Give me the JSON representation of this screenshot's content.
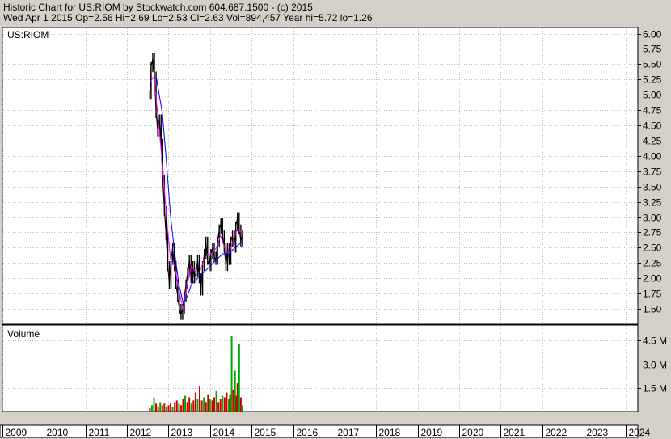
{
  "header": {
    "line1": "Historic Chart for US:RIOM by Stockwatch.com 604.687.1500 - (c) 2015",
    "line2": "Wed Apr  1 2015  Op=2.56  Hi=2.69  Lo=2.53  Cl=2.63  Vol=894,457  Year hi=5.72  lo=1.26"
  },
  "colors": {
    "background": "#ffffff",
    "frame": "#d4d0c8",
    "price_bars": "#000000",
    "ma_short": "#ff00ff",
    "ma_long": "#0000ff",
    "volume_up": "#00aa00",
    "volume_down": "#cc0000"
  },
  "chart_data": [
    {
      "type": "line",
      "title": "US:RIOM",
      "y_ticks": [
        "1.50",
        "1.75",
        "2.00",
        "2.25",
        "2.50",
        "2.75",
        "3.00",
        "3.25",
        "3.50",
        "3.75",
        "4.00",
        "4.25",
        "4.50",
        "4.75",
        "5.00",
        "5.25",
        "5.50",
        "5.75",
        "6.00"
      ],
      "ylim": [
        1.25,
        6.1
      ],
      "y_axis_side": "right",
      "grid": true,
      "x_labels": [
        "2009",
        "2010",
        "2011",
        "2012",
        "2013",
        "2014",
        "2015",
        "2016",
        "2017",
        "2018",
        "2019",
        "2020",
        "2021",
        "2022",
        "2023",
        "2024"
      ],
      "xlim": [
        2009.0,
        2024.3
      ],
      "series": [
        {
          "kind": "price",
          "points": [
            [
              2012.55,
              5.0
            ],
            [
              2012.58,
              5.45
            ],
            [
              2012.62,
              5.6
            ],
            [
              2012.66,
              5.3
            ],
            [
              2012.7,
              4.7
            ],
            [
              2012.74,
              4.4
            ],
            [
              2012.78,
              4.6
            ],
            [
              2012.82,
              4.2
            ],
            [
              2012.86,
              3.6
            ],
            [
              2012.9,
              3.1
            ],
            [
              2012.94,
              2.7
            ],
            [
              2012.98,
              2.2
            ],
            [
              2013.02,
              1.9
            ],
            [
              2013.06,
              2.3
            ],
            [
              2013.1,
              2.5
            ],
            [
              2013.14,
              2.2
            ],
            [
              2013.18,
              1.9
            ],
            [
              2013.22,
              1.7
            ],
            [
              2013.26,
              1.5
            ],
            [
              2013.3,
              1.4
            ],
            [
              2013.34,
              1.5
            ],
            [
              2013.38,
              1.7
            ],
            [
              2013.42,
              1.9
            ],
            [
              2013.46,
              2.1
            ],
            [
              2013.5,
              2.3
            ],
            [
              2013.54,
              2.0
            ],
            [
              2013.58,
              2.2
            ],
            [
              2013.62,
              2.0
            ],
            [
              2013.66,
              2.1
            ],
            [
              2013.7,
              2.3
            ],
            [
              2013.74,
              2.0
            ],
            [
              2013.78,
              1.8
            ],
            [
              2013.82,
              2.2
            ],
            [
              2013.86,
              2.4
            ],
            [
              2013.9,
              2.6
            ],
            [
              2013.94,
              2.3
            ],
            [
              2013.98,
              2.2
            ],
            [
              2014.02,
              2.4
            ],
            [
              2014.06,
              2.5
            ],
            [
              2014.1,
              2.35
            ],
            [
              2014.14,
              2.3
            ],
            [
              2014.18,
              2.6
            ],
            [
              2014.22,
              2.8
            ],
            [
              2014.26,
              2.9
            ],
            [
              2014.3,
              2.7
            ],
            [
              2014.34,
              2.5
            ],
            [
              2014.38,
              2.2
            ],
            [
              2014.42,
              2.5
            ],
            [
              2014.46,
              2.3
            ],
            [
              2014.5,
              2.6
            ],
            [
              2014.54,
              2.7
            ],
            [
              2014.58,
              2.5
            ],
            [
              2014.62,
              2.85
            ],
            [
              2014.66,
              3.0
            ],
            [
              2014.7,
              2.8
            ],
            [
              2014.74,
              2.6
            ],
            [
              2014.78,
              2.7
            ]
          ]
        },
        {
          "kind": "moving_average_short",
          "points": [
            [
              2012.55,
              5.2
            ],
            [
              2012.65,
              5.3
            ],
            [
              2012.75,
              4.6
            ],
            [
              2012.85,
              3.9
            ],
            [
              2012.95,
              3.0
            ],
            [
              2013.05,
              2.3
            ],
            [
              2013.15,
              2.2
            ],
            [
              2013.25,
              1.8
            ],
            [
              2013.35,
              1.5
            ],
            [
              2013.45,
              1.9
            ],
            [
              2013.55,
              2.2
            ],
            [
              2013.65,
              2.1
            ],
            [
              2013.75,
              2.1
            ],
            [
              2013.85,
              2.3
            ],
            [
              2013.95,
              2.4
            ],
            [
              2014.05,
              2.4
            ],
            [
              2014.15,
              2.5
            ],
            [
              2014.25,
              2.7
            ],
            [
              2014.35,
              2.5
            ],
            [
              2014.45,
              2.4
            ],
            [
              2014.55,
              2.6
            ],
            [
              2014.65,
              2.8
            ],
            [
              2014.78,
              2.75
            ]
          ]
        },
        {
          "kind": "moving_average_long",
          "points": [
            [
              2012.7,
              5.3
            ],
            [
              2012.85,
              4.7
            ],
            [
              2012.95,
              3.9
            ],
            [
              2013.05,
              3.0
            ],
            [
              2013.15,
              2.4
            ],
            [
              2013.25,
              1.9
            ],
            [
              2013.35,
              1.6
            ],
            [
              2013.45,
              1.7
            ],
            [
              2013.55,
              1.9
            ],
            [
              2013.7,
              2.0
            ],
            [
              2013.85,
              2.1
            ],
            [
              2014.0,
              2.2
            ],
            [
              2014.15,
              2.3
            ],
            [
              2014.3,
              2.4
            ],
            [
              2014.45,
              2.4
            ],
            [
              2014.6,
              2.5
            ],
            [
              2014.78,
              2.6
            ]
          ]
        }
      ]
    },
    {
      "type": "bar",
      "title": "Volume",
      "y_ticks": [
        "1.5 M",
        "3.0 M",
        "4.5 M"
      ],
      "y_tick_values": [
        1.5,
        3.0,
        4.5
      ],
      "ylim": [
        0,
        5.5
      ],
      "unit": "M",
      "grid": true,
      "bars": [
        [
          2012.55,
          0.2,
          "d"
        ],
        [
          2012.6,
          0.4,
          "u"
        ],
        [
          2012.65,
          0.9,
          "u"
        ],
        [
          2012.7,
          0.5,
          "d"
        ],
        [
          2012.75,
          0.3,
          "d"
        ],
        [
          2012.8,
          0.6,
          "u"
        ],
        [
          2012.85,
          0.4,
          "d"
        ],
        [
          2012.9,
          0.5,
          "d"
        ],
        [
          2012.95,
          0.3,
          "u"
        ],
        [
          2013.0,
          0.4,
          "d"
        ],
        [
          2013.05,
          0.5,
          "d"
        ],
        [
          2013.1,
          0.3,
          "u"
        ],
        [
          2013.15,
          0.6,
          "d"
        ],
        [
          2013.2,
          0.7,
          "d"
        ],
        [
          2013.25,
          0.5,
          "u"
        ],
        [
          2013.3,
          0.4,
          "d"
        ],
        [
          2013.35,
          0.8,
          "d"
        ],
        [
          2013.4,
          1.0,
          "u"
        ],
        [
          2013.45,
          0.6,
          "d"
        ],
        [
          2013.5,
          0.9,
          "d"
        ],
        [
          2013.55,
          0.5,
          "u"
        ],
        [
          2013.6,
          0.7,
          "d"
        ],
        [
          2013.65,
          1.2,
          "d"
        ],
        [
          2013.7,
          0.8,
          "u"
        ],
        [
          2013.75,
          1.6,
          "d"
        ],
        [
          2013.8,
          0.7,
          "d"
        ],
        [
          2013.85,
          0.9,
          "u"
        ],
        [
          2013.9,
          0.6,
          "d"
        ],
        [
          2013.95,
          1.1,
          "d"
        ],
        [
          2014.0,
          0.8,
          "u"
        ],
        [
          2014.05,
          0.7,
          "d"
        ],
        [
          2014.1,
          0.9,
          "d"
        ],
        [
          2014.15,
          1.3,
          "u"
        ],
        [
          2014.2,
          0.6,
          "d"
        ],
        [
          2014.25,
          0.8,
          "d"
        ],
        [
          2014.3,
          1.0,
          "u"
        ],
        [
          2014.35,
          0.9,
          "d"
        ],
        [
          2014.4,
          1.2,
          "d"
        ],
        [
          2014.45,
          0.8,
          "u"
        ],
        [
          2014.48,
          1.1,
          "d"
        ],
        [
          2014.52,
          4.8,
          "u"
        ],
        [
          2014.56,
          1.4,
          "d"
        ],
        [
          2014.6,
          2.6,
          "u"
        ],
        [
          2014.63,
          1.0,
          "d"
        ],
        [
          2014.66,
          1.8,
          "d"
        ],
        [
          2014.7,
          4.3,
          "u"
        ],
        [
          2014.74,
          0.9,
          "d"
        ],
        [
          2014.78,
          0.4,
          "u"
        ]
      ]
    }
  ]
}
